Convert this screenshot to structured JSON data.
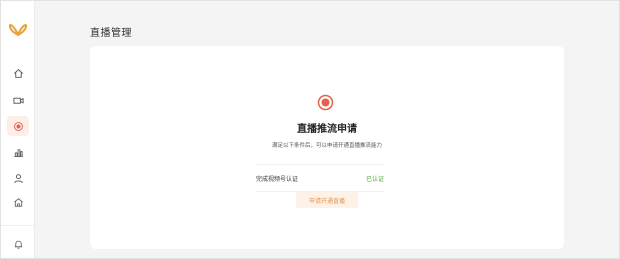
{
  "app": {
    "accent_color": "#e8a33a",
    "active_color": "#e2634a",
    "success_color": "#52a83a"
  },
  "sidebar": {
    "logo_icon": "butterfly-logo-icon",
    "items": [
      {
        "icon": "home-icon",
        "active": false
      },
      {
        "icon": "video-camera-icon",
        "active": false
      },
      {
        "icon": "live-record-icon",
        "active": true
      },
      {
        "icon": "chart-icon",
        "active": false
      },
      {
        "icon": "user-icon",
        "active": false
      },
      {
        "icon": "shop-icon",
        "active": false
      }
    ],
    "bottom_icon": "bell-icon"
  },
  "main": {
    "title": "直播管理",
    "card": {
      "status_icon": "record-circle-icon",
      "heading": "直播推流申请",
      "description": "满足以下条件后，可以申请开通直播推流能力",
      "requirement": {
        "label": "完成视频号认证",
        "status": "已认证"
      },
      "apply_button": "申请开通直播"
    }
  }
}
